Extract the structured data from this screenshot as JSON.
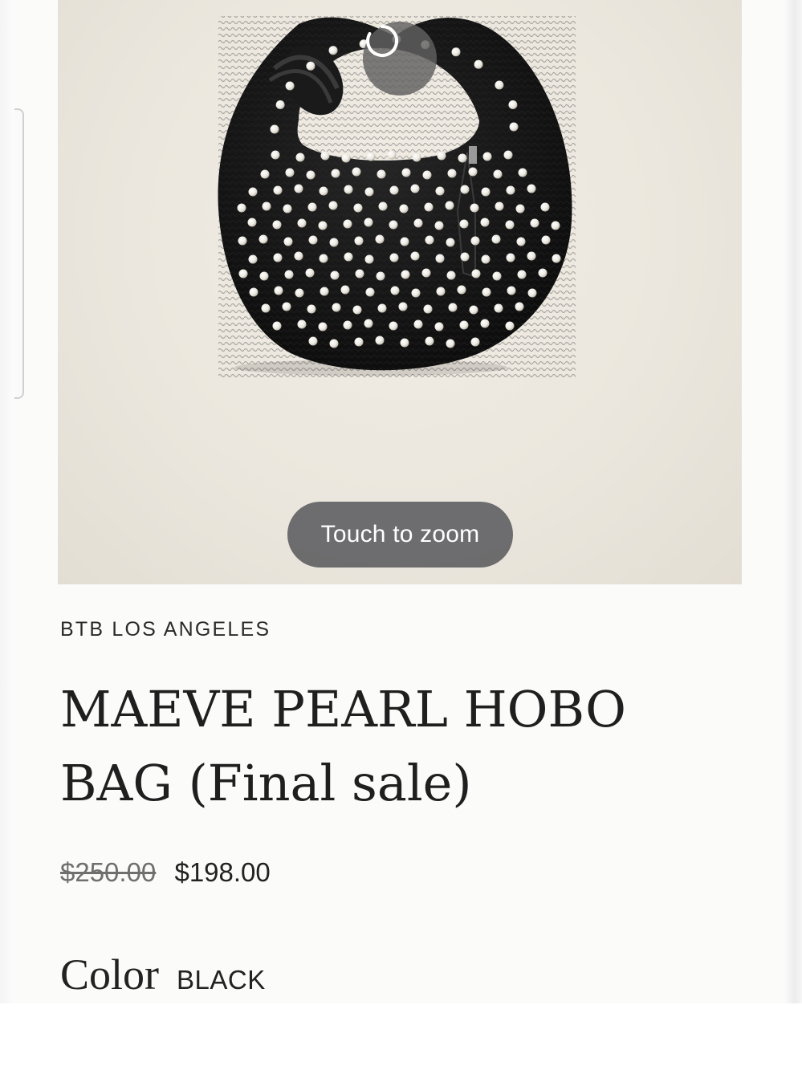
{
  "product": {
    "image_alt": "Black woven hobo bag with pearl embellishments",
    "zoom_hint": "Touch to zoom",
    "brand": "BTB LOS ANGELES",
    "title": "MAEVE PEARL HOBO BAG (Final sale)",
    "price_original": "$250.00",
    "price_sale": "$198.00",
    "color_label": "Color",
    "color_value": "BLACK"
  },
  "icons": {
    "spinner": "loading-spinner-icon"
  },
  "colors": {
    "background": "#fbfbfa",
    "image_bg": "#ebe7de",
    "bag": "#141414",
    "pearl": "#f2f0ea",
    "chip": "#626264"
  }
}
